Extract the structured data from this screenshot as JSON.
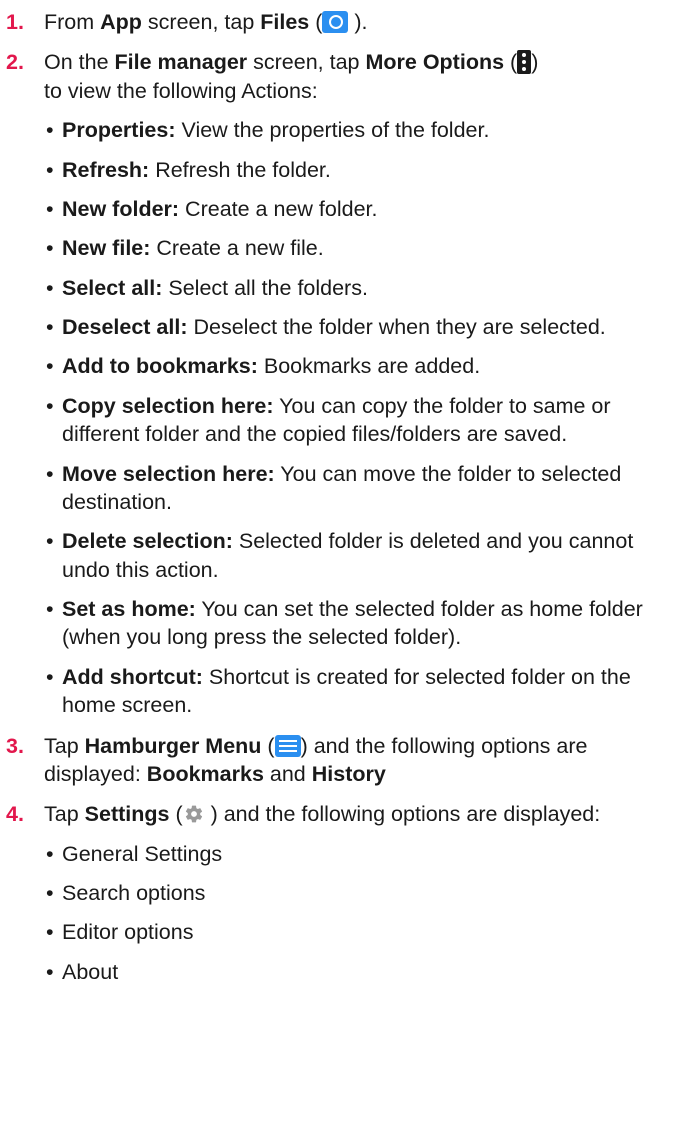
{
  "steps": [
    {
      "number": "1.",
      "parts": [
        "From ",
        "App",
        " screen, tap ",
        "Files",
        " (",
        " )."
      ],
      "icon": "files-app-icon"
    },
    {
      "number": "2.",
      "parts": [
        "On the ",
        "File manager",
        " screen, tap ",
        "More Options",
        " (",
        ")",
        "to view the following Actions:"
      ],
      "icon": "more-options-icon",
      "actions": [
        {
          "term": "Properties:",
          "desc": " View the properties of the folder."
        },
        {
          "term": "Refresh:",
          "desc": " Refresh the folder."
        },
        {
          "term": "New folder:",
          "desc": " Create a new folder."
        },
        {
          "term": "New file:",
          "desc": " Create a new file."
        },
        {
          "term": "Select all:",
          "desc": " Select all the folders."
        },
        {
          "term": "Deselect all:",
          "desc": " Deselect the folder when they are selected."
        },
        {
          "term": "Add to bookmarks:",
          "desc": " Bookmarks are added."
        },
        {
          "term": "Copy selection here:",
          "desc": " You can copy the folder to same or different folder and the copied files/folders are saved."
        },
        {
          "term": "Move selection here:",
          "desc": " You can move the folder to selected destination."
        },
        {
          "term": "Delete selection:",
          "desc": " Selected folder is deleted and you cannot undo this action."
        },
        {
          "term": "Set as home:",
          "desc": " You can set the selected folder as home folder (when you long press the selected folder)."
        },
        {
          "term": "Add shortcut:",
          "desc": " Shortcut is created for selected folder on the home screen."
        }
      ]
    },
    {
      "number": "3.",
      "parts": [
        "Tap ",
        "Hamburger Menu",
        " (",
        ") and the following options are displayed: ",
        "Bookmarks",
        " and ",
        "History"
      ],
      "icon": "hamburger-menu-icon"
    },
    {
      "number": "4.",
      "parts": [
        "Tap ",
        "Settings",
        " (",
        " ) and the following options are displayed:"
      ],
      "icon": "gear-icon",
      "options": [
        "General Settings",
        "Search options",
        "Editor options",
        "About"
      ]
    }
  ],
  "colors": {
    "step_number": "#e2174c",
    "icon_blue": "#2b8ff0",
    "text": "#1a1a1a"
  }
}
